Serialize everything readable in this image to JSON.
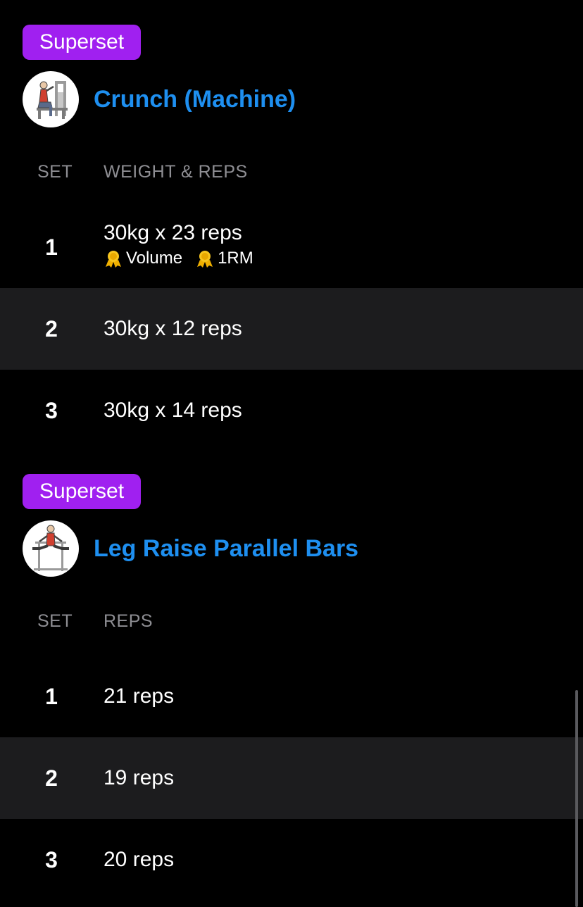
{
  "accent": "#1e8ff0",
  "superset_color": "#a020f0",
  "badge_icon": "medal-icon",
  "exercises": [
    {
      "badge": "Superset",
      "title": "Crunch (Machine)",
      "thumbnail": "crunch-machine-illustration",
      "col_set": "SET",
      "col_value": "WEIGHT & REPS",
      "sets": [
        {
          "num": "1",
          "value": "30kg x 23 reps",
          "records": [
            "Volume",
            "1RM"
          ]
        },
        {
          "num": "2",
          "value": "30kg x 12 reps"
        },
        {
          "num": "3",
          "value": "30kg x 14 reps"
        }
      ]
    },
    {
      "badge": "Superset",
      "title": "Leg Raise Parallel Bars",
      "thumbnail": "leg-raise-parallel-bars-illustration",
      "col_set": "SET",
      "col_value": "REPS",
      "sets": [
        {
          "num": "1",
          "value": "21 reps"
        },
        {
          "num": "2",
          "value": "19 reps"
        },
        {
          "num": "3",
          "value": "20 reps"
        }
      ]
    }
  ]
}
